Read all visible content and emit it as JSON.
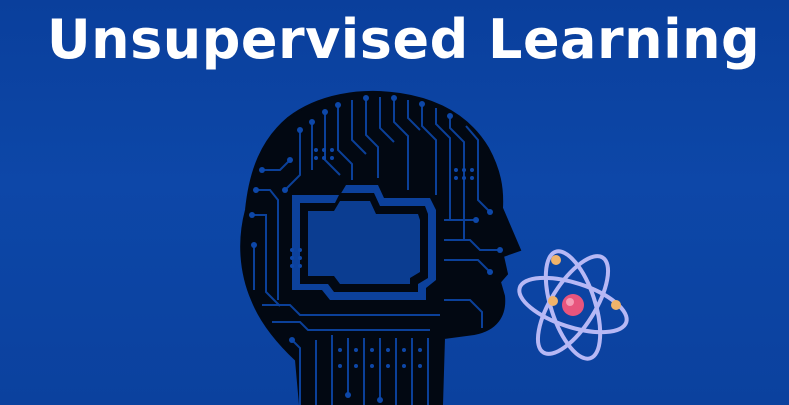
{
  "title": "Unsupervised Learning",
  "icons": {
    "head": "circuit-head-icon",
    "atom": "atom-icon"
  },
  "colors": {
    "background": "#0d47a8",
    "title": "#ffffff",
    "head_fill": "#020812",
    "circuit_trace": "#0d47a8",
    "atom_orbit": "#b7b8f5",
    "atom_nucleus": "#e8557d",
    "atom_electron": "#f0b36a"
  }
}
